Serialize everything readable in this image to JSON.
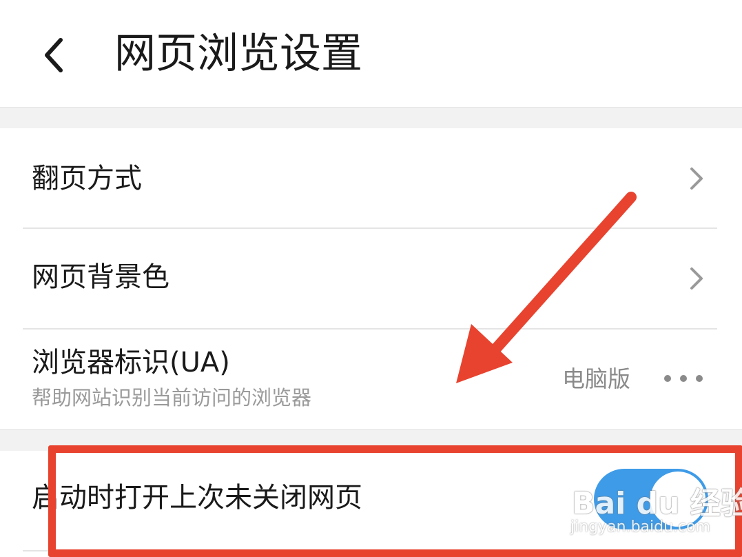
{
  "header": {
    "title": "网页浏览设置",
    "back_icon": "chevron-left-icon"
  },
  "settings": {
    "page_turn": {
      "label": "翻页方式",
      "icon": "chevron-right-icon"
    },
    "background_color": {
      "label": "网页背景色",
      "icon": "chevron-right-icon"
    },
    "user_agent": {
      "label": "浏览器标识(UA)",
      "description": "帮助网站识别当前访问的浏览器",
      "value": "电脑版",
      "icon": "more-icon"
    },
    "restore_tabs": {
      "label": "启动时打开上次未关闭网页",
      "enabled": true
    }
  },
  "annotation": {
    "color": "#e8432f"
  },
  "watermark": {
    "logo_text": "Bai du 经验",
    "url": "jingyan.baidu.com"
  },
  "colors": {
    "toggle_on": "#3e9be8",
    "text_primary": "#1a1a1a",
    "text_secondary": "#9a9a9a"
  }
}
